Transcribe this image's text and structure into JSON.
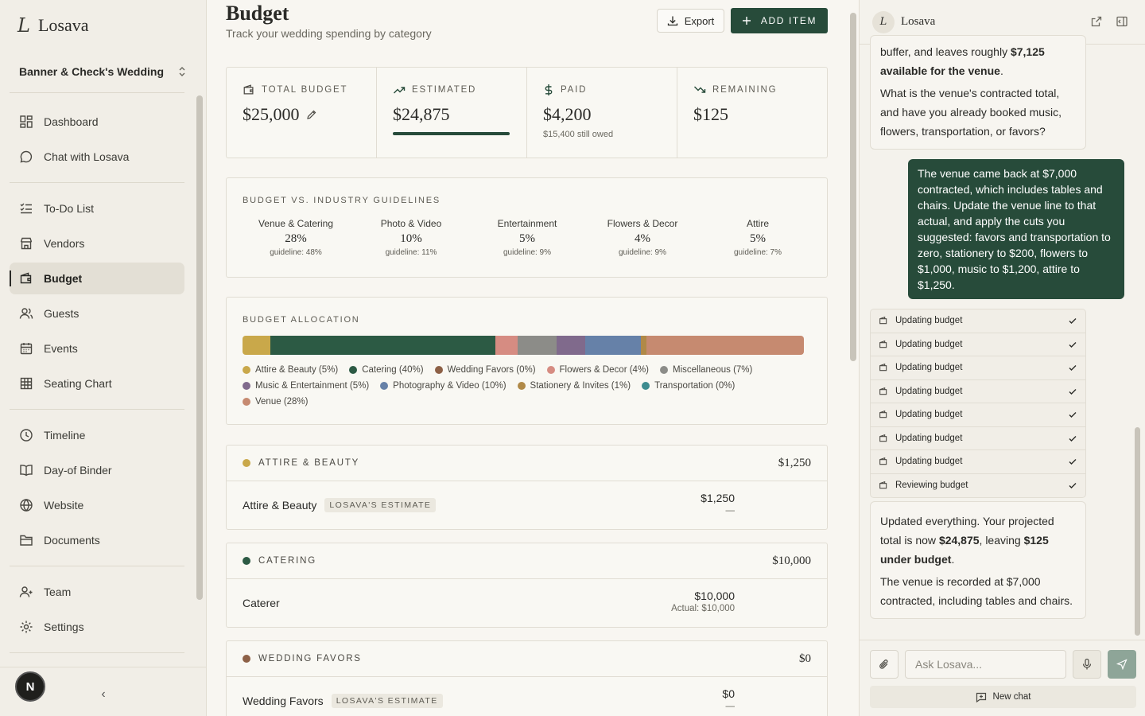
{
  "app": {
    "name": "Losava",
    "logo_glyph": "L"
  },
  "sidebar": {
    "wedding_name": "Banner & Check's Wedding",
    "items": [
      {
        "label": "Dashboard",
        "icon": "dashboard-icon"
      },
      {
        "label": "Chat with Losava",
        "icon": "chat-icon"
      },
      {
        "label": "To-Do List",
        "icon": "list-check-icon"
      },
      {
        "label": "Vendors",
        "icon": "store-icon"
      },
      {
        "label": "Budget",
        "icon": "wallet-icon",
        "active": true
      },
      {
        "label": "Guests",
        "icon": "users-icon"
      },
      {
        "label": "Events",
        "icon": "calendar-icon"
      },
      {
        "label": "Seating Chart",
        "icon": "grid-icon"
      },
      {
        "label": "Timeline",
        "icon": "clock-icon"
      },
      {
        "label": "Day-of Binder",
        "icon": "book-icon"
      },
      {
        "label": "Website",
        "icon": "globe-icon"
      },
      {
        "label": "Documents",
        "icon": "folder-icon"
      },
      {
        "label": "Team",
        "icon": "team-icon"
      },
      {
        "label": "Settings",
        "icon": "settings-icon"
      }
    ],
    "avatar_initial": "N",
    "collapse_glyph": "‹"
  },
  "header": {
    "title": "Budget",
    "subtitle": "Track your wedding spending by category",
    "export_label": "Export",
    "add_label": "ADD ITEM"
  },
  "stats": [
    {
      "label": "TOTAL BUDGET",
      "value": "$25,000",
      "note": "",
      "icon": "wallet-icon"
    },
    {
      "label": "ESTIMATED",
      "value": "$24,875",
      "note": "",
      "icon": "trend-up-icon",
      "progress": 0.995
    },
    {
      "label": "PAID",
      "value": "$4,200",
      "note": "$15,400 still owed",
      "icon": "dollar-icon"
    },
    {
      "label": "REMAINING",
      "value": "$125",
      "note": "",
      "icon": "trend-down-icon"
    }
  ],
  "guidelines": {
    "title": "BUDGET VS. INDUSTRY GUIDELINES",
    "items": [
      {
        "name": "Venue & Catering",
        "value": "28%",
        "guideline": "guideline: 48%"
      },
      {
        "name": "Photo & Video",
        "value": "10%",
        "guideline": "guideline: 11%"
      },
      {
        "name": "Entertainment",
        "value": "5%",
        "guideline": "guideline: 9%"
      },
      {
        "name": "Flowers & Decor",
        "value": "4%",
        "guideline": "guideline: 9%"
      },
      {
        "name": "Attire",
        "value": "5%",
        "guideline": "guideline: 7%"
      }
    ]
  },
  "allocation": {
    "title": "BUDGET ALLOCATION",
    "segments": [
      {
        "label": "Attire & Beauty (5%)",
        "pct": 5,
        "color": "#c9a84a"
      },
      {
        "label": "Catering (40%)",
        "pct": 40,
        "color": "#2c5a44"
      },
      {
        "label": "Wedding Favors (0%)",
        "pct": 0,
        "color": "#8d6046"
      },
      {
        "label": "Flowers & Decor (4%)",
        "pct": 4,
        "color": "#d68c82"
      },
      {
        "label": "Miscellaneous (7%)",
        "pct": 7,
        "color": "#8c8c88"
      },
      {
        "label": "Music & Entertainment (5%)",
        "pct": 5,
        "color": "#806a8c"
      },
      {
        "label": "Photography & Video (10%)",
        "pct": 10,
        "color": "#6681a8"
      },
      {
        "label": "Stationery & Invites (1%)",
        "pct": 1,
        "color": "#b08947"
      },
      {
        "label": "Transportation (0%)",
        "pct": 0,
        "color": "#3d8c8f"
      },
      {
        "label": "Venue (28%)",
        "pct": 28,
        "color": "#c68a70"
      }
    ]
  },
  "categories": [
    {
      "name": "ATTIRE & BEAUTY",
      "total": "$1,250",
      "color": "#c9a84a",
      "row": {
        "name": "Attire & Beauty",
        "badge": "LOSAVA'S ESTIMATE",
        "amount": "$1,250",
        "sub": "—"
      }
    },
    {
      "name": "CATERING",
      "total": "$10,000",
      "color": "#2c5a44",
      "row": {
        "name": "Caterer",
        "badge": "",
        "amount": "$10,000",
        "sub": "Actual: $10,000"
      }
    },
    {
      "name": "WEDDING FAVORS",
      "total": "$0",
      "color": "#8d6046",
      "row": {
        "name": "Wedding Favors",
        "badge": "LOSAVA'S ESTIMATE",
        "amount": "$0",
        "sub": "—"
      }
    }
  ],
  "chat": {
    "title": "Losava",
    "ai_msg_1": {
      "line1a": "buffer, and leaves roughly ",
      "line1b": "$7,125 available for the venue",
      "line1c": ".",
      "p2": "What is the venue's contracted total, and have you already booked music, flowers, transportation, or favors?"
    },
    "user_msg": "The venue came back at $7,000 contracted, which includes tables and chairs. Update the venue line to that actual, and apply the cuts you suggested: favors and transportation to zero, stationery to $200, flowers to $1,000, music to $1,200, attire to $1,250.",
    "tools": [
      "Updating budget",
      "Updating budget",
      "Updating budget",
      "Updating budget",
      "Updating budget",
      "Updating budget",
      "Updating budget",
      "Reviewing budget"
    ],
    "ai_msg_2": {
      "a": "Updated everything. Your projected total is now ",
      "b": "$24,875",
      "c": ", leaving ",
      "d": "$125 under budget",
      "e": ".",
      "p2": "The venue is recorded at $7,000 contracted, including tables and chairs."
    },
    "input_placeholder": "Ask Losava...",
    "new_chat_label": "New chat"
  }
}
